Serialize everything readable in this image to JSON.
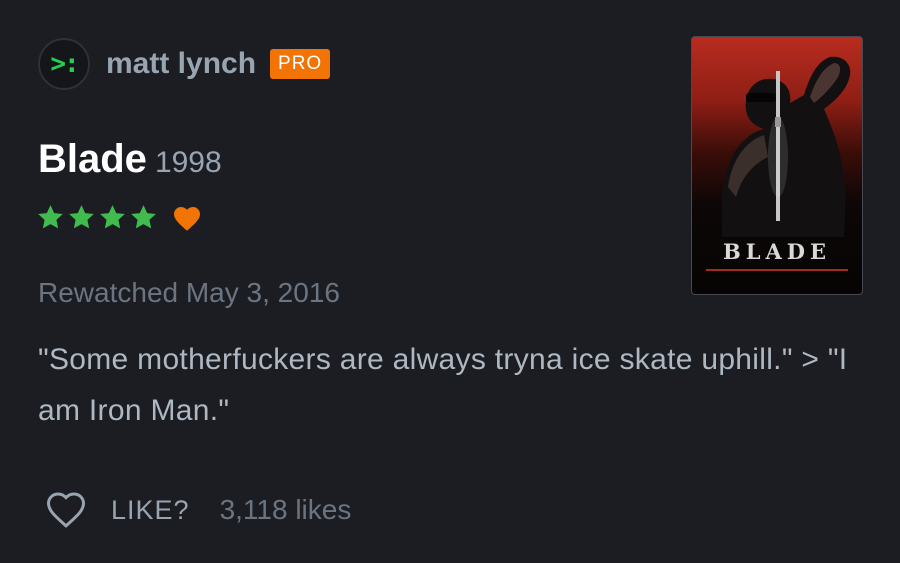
{
  "author": {
    "avatar_text": ">:",
    "name": "matt lynch",
    "badge": "PRO"
  },
  "film": {
    "title": "Blade",
    "year": "1998",
    "poster_title": "BLADE"
  },
  "rating": {
    "stars": 4,
    "max_stars": 5,
    "liked": true,
    "star_color": "#40bc4f",
    "heart_color": "#f27405"
  },
  "watch": {
    "label": "Rewatched May 3, 2016"
  },
  "review": {
    "text": "\"Some motherfuckers are always tryna ice skate uphill.\" > \"I am Iron Man.\""
  },
  "actions": {
    "like_label": "LIKE?",
    "like_count": "3,118 likes"
  },
  "colors": {
    "background": "#1c1d22",
    "pro_badge": "#f27405",
    "avatar_text": "#23d152"
  }
}
